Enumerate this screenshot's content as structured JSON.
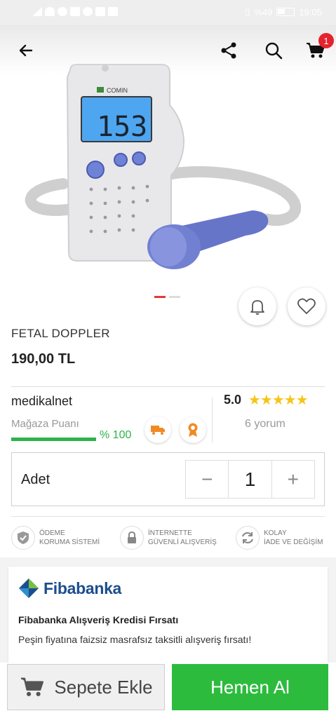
{
  "statusbar": {
    "battery": "%49",
    "time": "19:05"
  },
  "nav": {
    "cart_count": "1"
  },
  "product": {
    "title": "FETAL DOPPLER",
    "price": "190,00 TL",
    "device_brand": "COMIN",
    "device_display": "153"
  },
  "seller": {
    "name": "medikalnet",
    "store_score_label": "Mağaza Puanı",
    "store_score_pct": "% 100",
    "rating": "5.0",
    "stars": "★★★★★",
    "reviews": "6 yorum"
  },
  "quantity": {
    "label": "Adet",
    "value": "1",
    "minus": "−",
    "plus": "+"
  },
  "features": [
    {
      "line1": "ÖDEME",
      "line2": "KORUMA SİSTEMİ"
    },
    {
      "line1": "İNTERNETTE",
      "line2": "GÜVENLİ ALIŞVERİŞ"
    },
    {
      "line1": "KOLAY",
      "line2": "İADE VE DEĞİŞİM"
    }
  ],
  "promo": {
    "bank": "Fibabanka",
    "title": "Fibabanka Alışveriş Kredisi Fırsatı",
    "desc": "Peşin fiyatına faizsiz masrafsız taksitli alışveriş fırsatı!"
  },
  "actions": {
    "add_to_cart": "Sepete Ekle",
    "buy_now": "Hemen Al"
  },
  "colors": {
    "accent_green": "#2dbb3e",
    "badge_red": "#e5232c",
    "fiba_blue": "#1c4e8c",
    "star_yellow": "#f5c518"
  }
}
